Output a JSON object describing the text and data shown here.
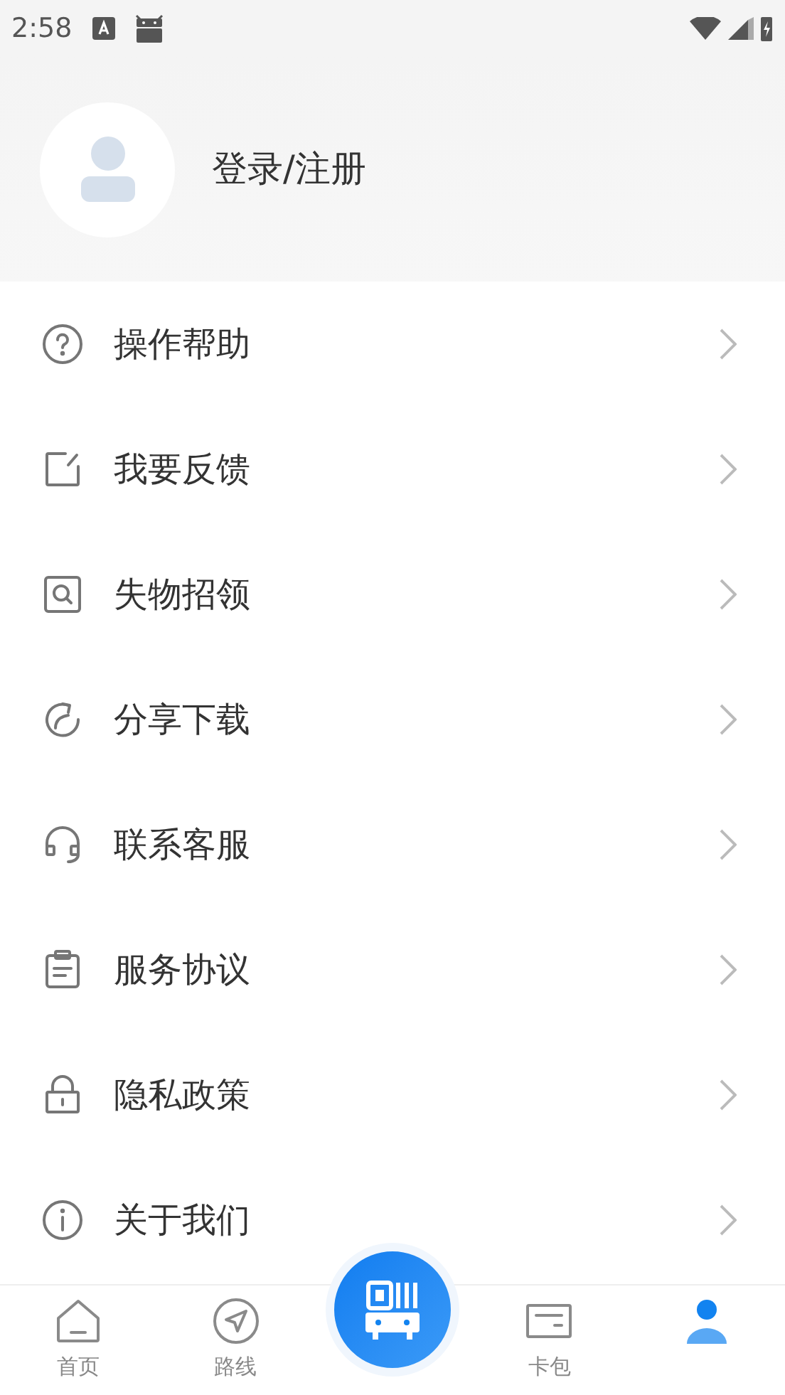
{
  "status_bar": {
    "time": "2:58"
  },
  "profile": {
    "login_label": "登录/注册"
  },
  "menu": [
    {
      "kind": "help",
      "label": "操作帮助"
    },
    {
      "kind": "feedback",
      "label": "我要反馈"
    },
    {
      "kind": "lost",
      "label": "失物招领"
    },
    {
      "kind": "share",
      "label": "分享下载"
    },
    {
      "kind": "service",
      "label": "联系客服"
    },
    {
      "kind": "agreement",
      "label": "服务协议"
    },
    {
      "kind": "privacy",
      "label": "隐私政策"
    },
    {
      "kind": "about",
      "label": "关于我们"
    }
  ],
  "bottom_nav": [
    {
      "kind": "home",
      "label": "首页",
      "selected": false
    },
    {
      "kind": "route",
      "label": "路线",
      "selected": false
    },
    {
      "kind": "scan",
      "selected": false
    },
    {
      "kind": "card",
      "label": "卡包",
      "selected": false
    },
    {
      "kind": "me",
      "selected": true
    }
  ]
}
